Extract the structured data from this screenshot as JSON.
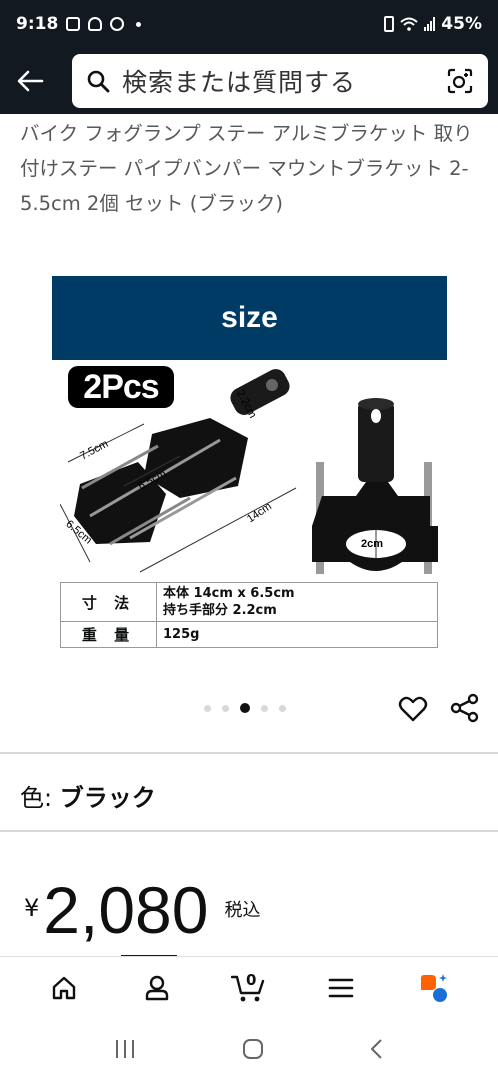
{
  "status_bar": {
    "time": "9:18",
    "battery": "45%"
  },
  "search": {
    "placeholder": "検索または質問する"
  },
  "product": {
    "title": "バイク フォグランプ ステー アルミブラケット 取り付けステー パイプバンパー マウントブラケット 2-5.5cm 2個 セット (ブラック)",
    "image": {
      "banner": "size",
      "badge": "2Pcs",
      "dims": {
        "length": "14cm",
        "width_top": "7.5cm",
        "width_inner": "6.5cm",
        "width_side": "6.5cm",
        "handle": "2.2cm",
        "bore": "2cm"
      },
      "spec_rows": [
        {
          "label": "寸 法",
          "lines": [
            "本体 14cm x 6.5cm",
            "持ち手部分 2.2cm"
          ]
        },
        {
          "label": "重 量",
          "lines": [
            "125g"
          ]
        }
      ]
    },
    "carousel": {
      "count": 5,
      "active_index": 2
    },
    "color": {
      "label": "色: ",
      "value": "ブラック"
    },
    "price": {
      "currency": "¥",
      "amount": "2,080",
      "tax_note": "税込"
    }
  },
  "bottom_nav": {
    "cart_count": "0"
  },
  "colors": {
    "header_bg": "#131921",
    "banner_bg": "#003b66",
    "rufus_orange": "#ff6200",
    "rufus_blue": "#1a6fd6"
  }
}
